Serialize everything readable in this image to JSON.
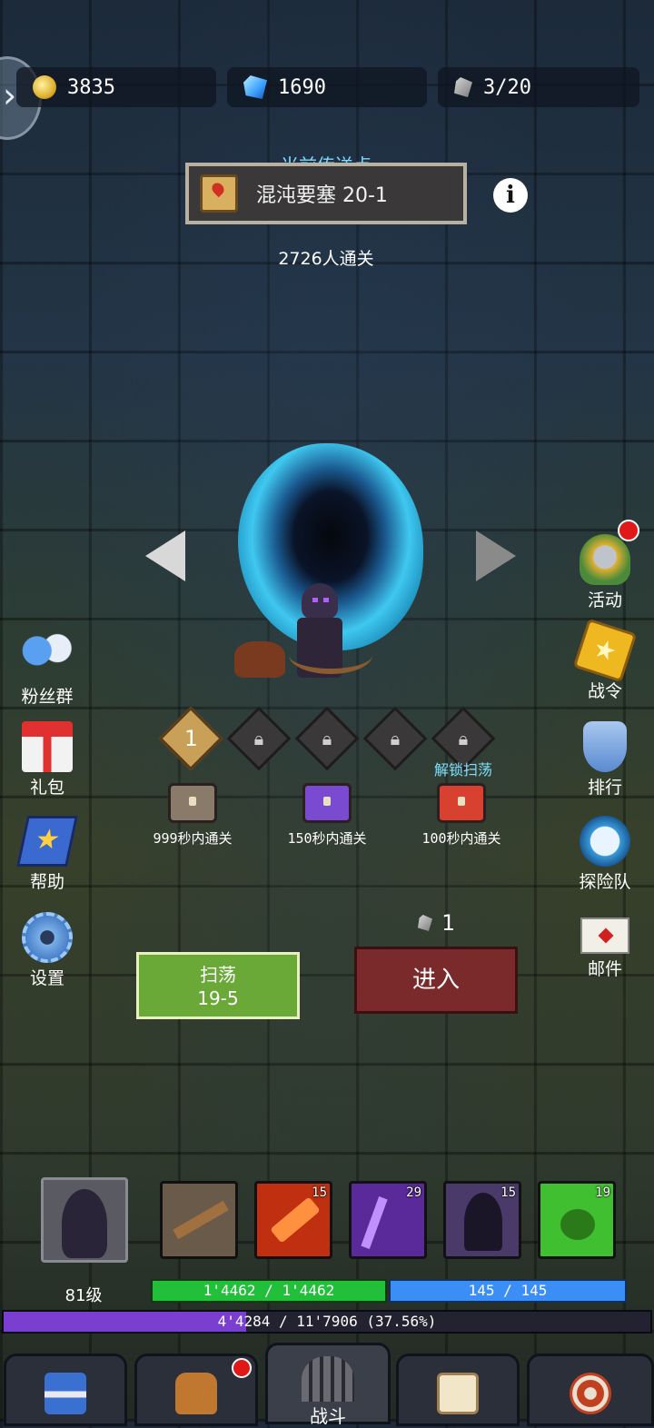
{
  "resources": {
    "gold": "3835",
    "gems": "1690",
    "stamina": "3/20"
  },
  "portal": {
    "header": "当前传送点",
    "location": "混沌要塞 20-1",
    "clear_count": "2726人通关"
  },
  "stage_slots": [
    {
      "label": "1",
      "locked": false
    },
    {
      "label": "",
      "locked": true
    },
    {
      "label": "",
      "locked": true
    },
    {
      "label": "",
      "locked": true
    },
    {
      "label": "",
      "locked": true
    }
  ],
  "unlock_sweep_label": "解锁扫荡",
  "chests": [
    {
      "label": "999秒内通关",
      "color": "#8a7a6a"
    },
    {
      "label": "150秒内通关",
      "color": "#7a4ad0"
    },
    {
      "label": "100秒内通关",
      "color": "#d84030"
    }
  ],
  "left_menu": [
    {
      "label": "粉丝群",
      "icon": "fan-group-icon"
    },
    {
      "label": "礼包",
      "icon": "gift-icon"
    },
    {
      "label": "帮助",
      "icon": "help-book-icon"
    },
    {
      "label": "设置",
      "icon": "gear-icon"
    }
  ],
  "right_menu": [
    {
      "label": "活动",
      "icon": "event-helmet-icon",
      "badge": true
    },
    {
      "label": "战令",
      "icon": "battle-pass-icon",
      "badge": false
    },
    {
      "label": "排行",
      "icon": "trophy-icon",
      "badge": false
    },
    {
      "label": "探险队",
      "icon": "expedition-clock-icon",
      "badge": false
    },
    {
      "label": "邮件",
      "icon": "mail-icon",
      "badge": false
    }
  ],
  "sweep_button": {
    "line1": "扫荡",
    "line2": "19-5"
  },
  "enter_button": {
    "label": "进入",
    "cost": "1"
  },
  "hero": {
    "level": "81级",
    "hp": "1'4462 / 1'4462",
    "mp": "145 / 145",
    "xp": "4'4284 / 11'7906 (37.56%)",
    "xp_percent": 37.56
  },
  "skills": [
    {
      "icon": "crossbow-bolts-icon",
      "level": "",
      "color": "#6a5a4a"
    },
    {
      "icon": "fire-crossbow-icon",
      "level": "15",
      "color": "#c03010"
    },
    {
      "icon": "shadow-arrows-icon",
      "level": "29",
      "color": "#5a2a9a"
    },
    {
      "icon": "hooded-assassin-icon",
      "level": "15",
      "color": "#4a3a6a"
    },
    {
      "icon": "green-paw-icon",
      "level": "19",
      "color": "#40c030"
    }
  ],
  "bottom_nav": [
    {
      "label": "",
      "icon": "shop-icon",
      "badge": false
    },
    {
      "label": "",
      "icon": "backpack-icon",
      "badge": true
    },
    {
      "label": "战斗",
      "icon": "dungeon-gate-icon",
      "badge": false,
      "active": true
    },
    {
      "label": "",
      "icon": "quest-book-icon",
      "badge": false
    },
    {
      "label": "",
      "icon": "target-icon",
      "badge": false
    }
  ],
  "colors": {
    "hp": "#22c03a",
    "mp": "#3b8ef5",
    "xp": "#7a3fd0",
    "sweep_bg": "#6aa838",
    "enter_bg": "#7a2a2a"
  }
}
